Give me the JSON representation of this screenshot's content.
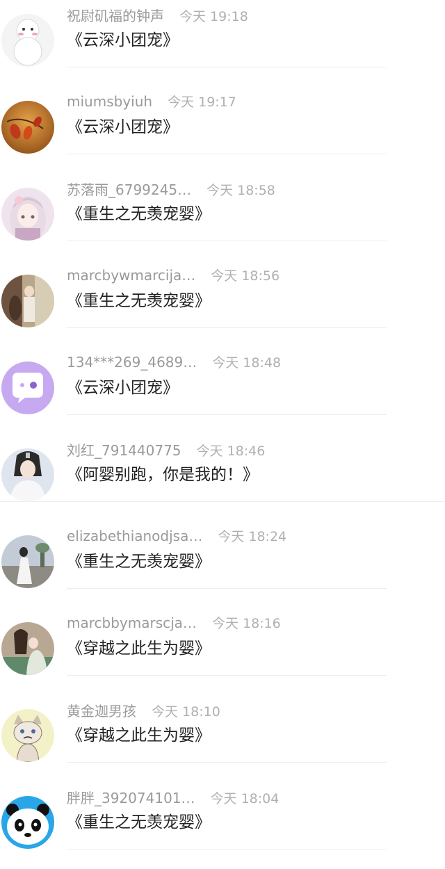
{
  "comments": [
    {
      "username": "祝尉矶福的钟声",
      "time": "今天 19:18",
      "message": "《云深小团宠》",
      "avatar": "snowman-avatar",
      "avatar_colors": [
        "#f4f4f4",
        "#e8a6b0"
      ]
    },
    {
      "username": "miumsbyiuh",
      "time": "今天 19:17",
      "message": "《云深小团宠》",
      "avatar": "autumn-leaves-avatar",
      "avatar_colors": [
        "#b5651d",
        "#d9822b"
      ]
    },
    {
      "username": "苏落雨_6799245…",
      "time": "今天 18:58",
      "message": "《重生之无羡宠婴》",
      "avatar": "anime-girl-avatar",
      "avatar_colors": [
        "#eee3ec",
        "#c9a7c3"
      ]
    },
    {
      "username": "marcbywmarcija…",
      "time": "今天 18:56",
      "message": "《重生之无羡宠婴》",
      "avatar": "illustration-avatar",
      "avatar_colors": [
        "#8a7058",
        "#c7b89b"
      ]
    },
    {
      "username": "134***269_4689…",
      "time": "今天 18:48",
      "message": "《云深小团宠》",
      "avatar": "chat-bubble-avatar",
      "avatar_colors": [
        "#c7a9f1",
        "#ffffff"
      ]
    },
    {
      "username": "刘红_791440775",
      "time": "今天 18:46",
      "message": "《阿婴别跑，你是我的！》",
      "avatar": "costume-man-avatar",
      "avatar_colors": [
        "#dfe5ee",
        "#2b2b2b"
      ]
    },
    {
      "username": "elizabethianodjsa…",
      "time": "今天 18:24",
      "message": "《重生之无羡宠婴》",
      "avatar": "photo-girl-avatar",
      "avatar_colors": [
        "#aab6c4",
        "#f2f2f2"
      ]
    },
    {
      "username": "marcbbymarscja…",
      "time": "今天 18:16",
      "message": "《穿越之此生为婴》",
      "avatar": "couple-illustration-avatar",
      "avatar_colors": [
        "#9d8b7a",
        "#5f8a6a"
      ]
    },
    {
      "username": "黄金迦男孩",
      "time": "今天 18:10",
      "message": "《穿越之此生为婴》",
      "avatar": "grumpy-cat-avatar",
      "avatar_colors": [
        "#f3f1c8",
        "#8c7a6a"
      ]
    },
    {
      "username": "胖胖_392074101…",
      "time": "今天 18:04",
      "message": "《重生之无羡宠婴》",
      "avatar": "panda-avatar",
      "avatar_colors": [
        "#2aa6e8",
        "#111111"
      ]
    }
  ]
}
